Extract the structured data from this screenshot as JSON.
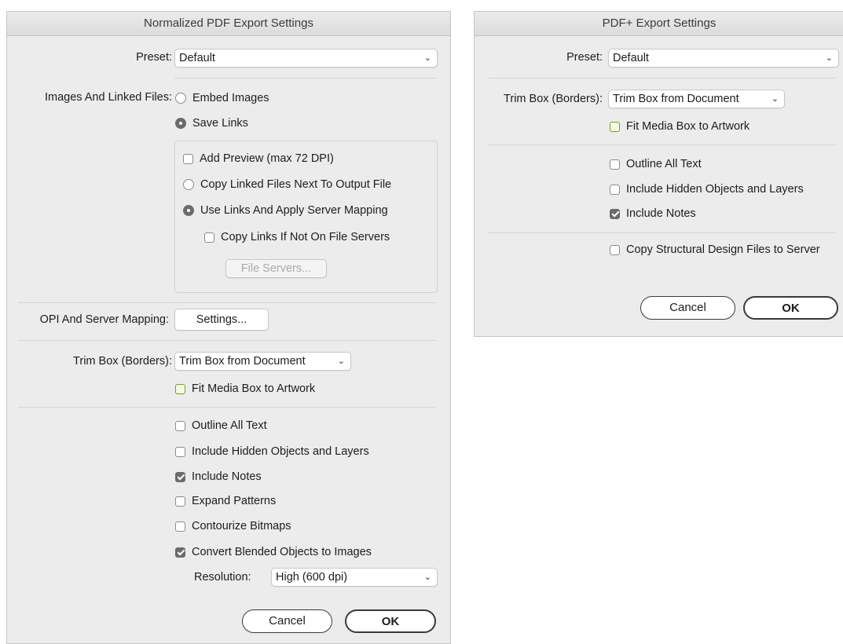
{
  "left_dialog": {
    "title": "Normalized PDF Export Settings",
    "preset_label": "Preset:",
    "preset_value": "Default",
    "images_label": "Images And Linked Files:",
    "embed_images": "Embed Images",
    "save_links": "Save Links",
    "add_preview": "Add Preview (max 72 DPI)",
    "copy_linked": "Copy Linked Files Next To Output File",
    "use_links": "Use Links And Apply Server Mapping",
    "copy_links_if": "Copy Links If Not On File Servers",
    "file_servers": "File Servers...",
    "opi_label": "OPI And Server Mapping:",
    "settings_button": "Settings...",
    "trim_label": "Trim Box (Borders):",
    "trim_value": "Trim Box from Document",
    "fit_media": "Fit Media Box to Artwork",
    "outline_text": "Outline All Text",
    "include_hidden": "Include Hidden Objects and Layers",
    "include_notes": "Include Notes",
    "expand_patterns": "Expand Patterns",
    "contourize": "Contourize Bitmaps",
    "convert_blended": "Convert Blended Objects to Images",
    "resolution_label": "Resolution:",
    "resolution_value": "High (600 dpi)",
    "cancel": "Cancel",
    "ok": "OK"
  },
  "right_dialog": {
    "title": "PDF+ Export Settings",
    "preset_label": "Preset:",
    "preset_value": "Default",
    "trim_label": "Trim Box (Borders):",
    "trim_value": "Trim Box from Document",
    "fit_media": "Fit Media Box to Artwork",
    "outline_text": "Outline All Text",
    "include_hidden": "Include Hidden Objects and Layers",
    "include_notes": "Include Notes",
    "copy_structural": "Copy Structural Design Files to Server",
    "cancel": "Cancel",
    "ok": "OK"
  },
  "states": {
    "embed_images": false,
    "save_links": true,
    "add_preview": false,
    "copy_linked": false,
    "use_links": true,
    "copy_links_if": false,
    "fit_media": false,
    "outline_text": false,
    "include_hidden": false,
    "include_notes": true,
    "expand_patterns": false,
    "contourize": false,
    "convert_blended": true,
    "copy_structural": false
  },
  "icons": {
    "dropdown": "chevron-down-icon",
    "checkbox": "checkbox",
    "radio": "radio-button"
  },
  "colors": {
    "dialog_bg": "#ececec",
    "checked": "#6b6b6b",
    "fit_media_border": "#7d9a2b"
  }
}
